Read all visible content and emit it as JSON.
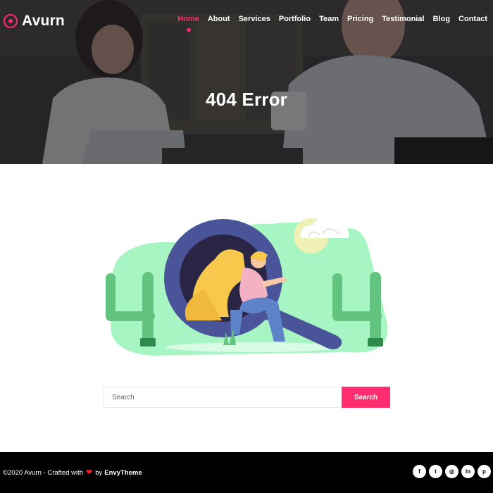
{
  "header": {
    "logo_text": "Avurn",
    "nav": [
      {
        "label": "Home",
        "active": true
      },
      {
        "label": "About"
      },
      {
        "label": "Services"
      },
      {
        "label": "Portfolio"
      },
      {
        "label": "Team"
      },
      {
        "label": "Pricing"
      },
      {
        "label": "Testimonial"
      },
      {
        "label": "Blog"
      },
      {
        "label": "Contact"
      }
    ]
  },
  "hero": {
    "title": "404 Error"
  },
  "search": {
    "placeholder": "Search",
    "button_label": "Search"
  },
  "footer": {
    "copyright_prefix": "©2020 Avurn - Crafted with",
    "heart": "❤",
    "by_text": "by",
    "brand": "EnvyTheme",
    "socials": [
      {
        "icon": "facebook-icon",
        "glyph": "f"
      },
      {
        "icon": "twitter-icon",
        "glyph": "t"
      },
      {
        "icon": "instagram-icon",
        "glyph": "◎"
      },
      {
        "icon": "linkedin-icon",
        "glyph": "in"
      },
      {
        "icon": "pinterest-icon",
        "glyph": "p"
      }
    ]
  },
  "colors": {
    "accent": "#ff2d6f",
    "footer_bg": "#000000",
    "blob_green": "#a6f5c2",
    "magnifier_blue": "#4a5498",
    "cactus_green": "#63c480"
  }
}
